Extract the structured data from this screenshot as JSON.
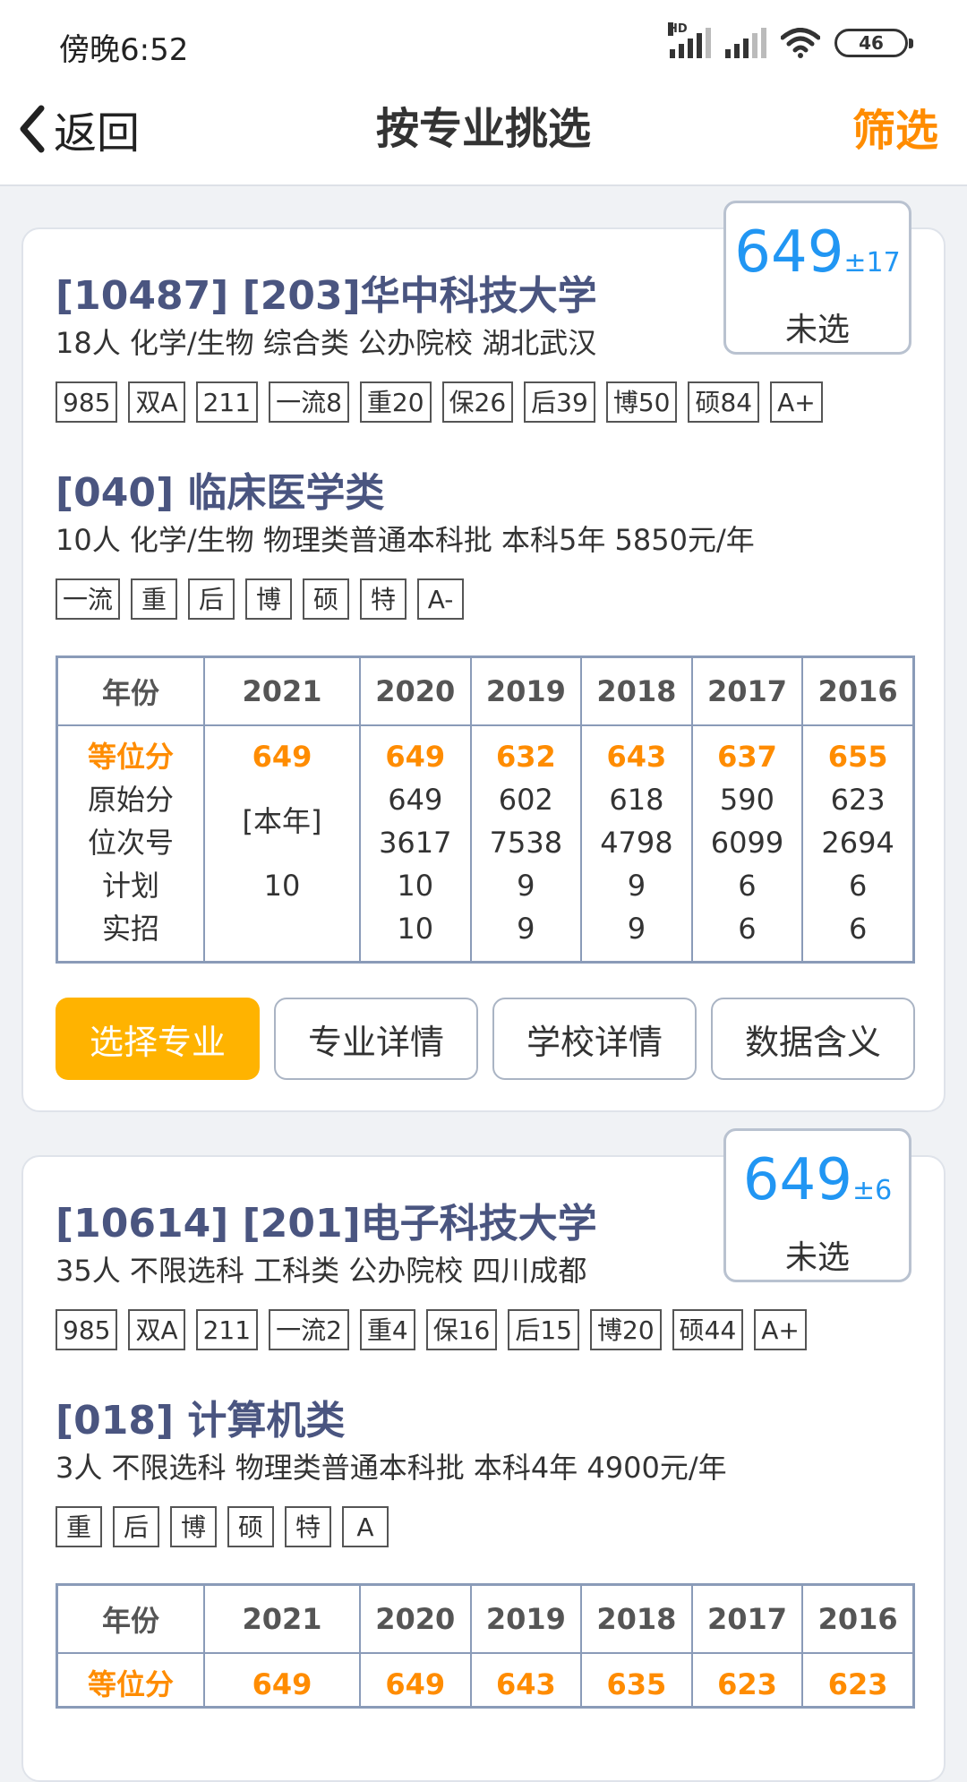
{
  "status": {
    "time": "傍晚6:52",
    "hd": "HD",
    "battery": "46"
  },
  "nav": {
    "back_icon": "chevron-left-icon",
    "back_label": "返回",
    "title": "按专业挑选",
    "filter_label": "筛选"
  },
  "colors": {
    "accent": "#ff8c00",
    "primary_button": "#ffb300",
    "score_blue": "#2196f3",
    "school_name": "#4a5580"
  },
  "cards": [
    {
      "score": "649",
      "score_delta": "±17",
      "selection_status": "未选",
      "school_name": "[10487] [203]华中科技大学",
      "school_info": "18人  化学/生物  综合类  公办院校  湖北武汉",
      "school_tags": [
        "985",
        "双A",
        "211",
        "一流8",
        "重20",
        "保26",
        "后39",
        "博50",
        "硕84",
        "A+"
      ],
      "major_name": "[040] 临床医学类",
      "major_info": "10人  化学/生物  物理类普通本科批  本科5年  5850元/年",
      "major_tags": [
        "一流",
        "重",
        "后",
        "博",
        "硕",
        "特",
        "A-"
      ],
      "table": {
        "headers": [
          "年份",
          "2021",
          "2020",
          "2019",
          "2018",
          "2017",
          "2016"
        ],
        "row_labels": [
          "等位分",
          "原始分",
          "位次号",
          "计划",
          "实招"
        ],
        "col_2021": [
          "649",
          "[本年]",
          "10"
        ],
        "years": [
          [
            "649",
            "649",
            "3617",
            "10",
            "10"
          ],
          [
            "632",
            "602",
            "7538",
            "9",
            "9"
          ],
          [
            "643",
            "618",
            "4798",
            "9",
            "9"
          ],
          [
            "637",
            "590",
            "6099",
            "6",
            "6"
          ],
          [
            "655",
            "623",
            "2694",
            "6",
            "6"
          ]
        ]
      },
      "buttons": [
        "选择专业",
        "专业详情",
        "学校详情",
        "数据含义"
      ]
    },
    {
      "score": "649",
      "score_delta": "±6",
      "selection_status": "未选",
      "school_name": "[10614] [201]电子科技大学",
      "school_info": "35人  不限选科  工科类  公办院校  四川成都",
      "school_tags": [
        "985",
        "双A",
        "211",
        "一流2",
        "重4",
        "保16",
        "后15",
        "博20",
        "硕44",
        "A+"
      ],
      "major_name": "[018] 计算机类",
      "major_info": "3人  不限选科  物理类普通本科批  本科4年  4900元/年",
      "major_tags": [
        "重",
        "后",
        "博",
        "硕",
        "特",
        "A"
      ],
      "table": {
        "headers": [
          "年份",
          "2021",
          "2020",
          "2019",
          "2018",
          "2017",
          "2016"
        ],
        "row_labels": [
          "等位分"
        ],
        "col_2021": [
          "649"
        ],
        "years": [
          [
            "649"
          ],
          [
            "643"
          ],
          [
            "635"
          ],
          [
            "623"
          ],
          [
            "623"
          ]
        ]
      }
    }
  ]
}
